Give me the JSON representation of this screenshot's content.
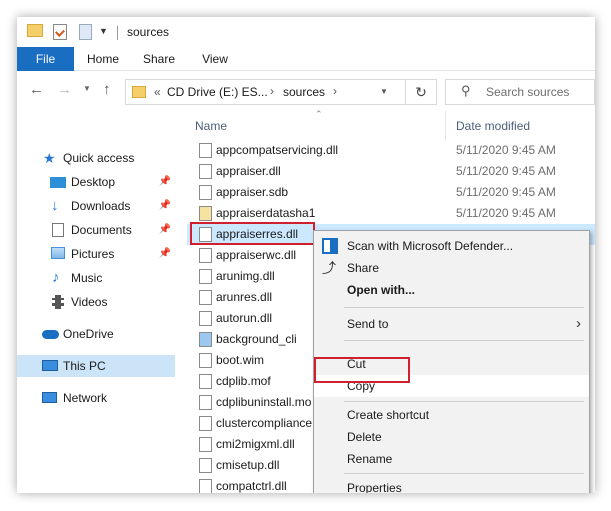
{
  "window": {
    "title": "sources"
  },
  "ribbon": {
    "tabs": [
      "File",
      "Home",
      "Share",
      "View"
    ]
  },
  "address": {
    "overflow": "«",
    "crumbs": [
      "CD Drive (E:) ES...",
      "sources"
    ],
    "search_placeholder": "Search sources"
  },
  "nav": {
    "quick_access": "Quick access",
    "items": [
      {
        "label": "Desktop",
        "pinned": true
      },
      {
        "label": "Downloads",
        "pinned": true
      },
      {
        "label": "Documents",
        "pinned": true
      },
      {
        "label": "Pictures",
        "pinned": true
      },
      {
        "label": "Music",
        "pinned": false
      },
      {
        "label": "Videos",
        "pinned": false
      }
    ],
    "onedrive": "OneDrive",
    "thispc": "This PC",
    "network": "Network"
  },
  "columns": {
    "name": "Name",
    "date": "Date modified"
  },
  "files": [
    {
      "name": "appcompatservicing.dll",
      "date": "5/11/2020 9:45 AM"
    },
    {
      "name": "appraiser.dll",
      "date": "5/11/2020 9:45 AM"
    },
    {
      "name": "appraiser.sdb",
      "date": "5/11/2020 9:45 AM"
    },
    {
      "name": "appraiserdatasha1",
      "date": "5/11/2020 9:45 AM"
    },
    {
      "name": "appraiserres.dll",
      "date": ""
    },
    {
      "name": "appraiserwc.dll",
      "date": ""
    },
    {
      "name": "arunimg.dll",
      "date": ""
    },
    {
      "name": "arunres.dll",
      "date": ""
    },
    {
      "name": "autorun.dll",
      "date": ""
    },
    {
      "name": "background_cli",
      "date": ""
    },
    {
      "name": "boot.wim",
      "date": ""
    },
    {
      "name": "cdplib.mof",
      "date": ""
    },
    {
      "name": "cdplibuninstall.mo",
      "date": ""
    },
    {
      "name": "clustercompliance",
      "date": ""
    },
    {
      "name": "cmi2migxml.dll",
      "date": ""
    },
    {
      "name": "cmisetup.dll",
      "date": ""
    },
    {
      "name": "compatctrl.dll",
      "date": ""
    }
  ],
  "context_menu": {
    "scan": "Scan with Microsoft Defender...",
    "share": "Share",
    "open_with": "Open with...",
    "send_to": "Send to",
    "cut": "Cut",
    "copy": "Copy",
    "create_shortcut": "Create shortcut",
    "delete": "Delete",
    "rename": "Rename",
    "properties": "Properties"
  },
  "colors": {
    "accent": "#1a6ec2",
    "highlight": "#d0202e",
    "selection": "#cce8ff"
  }
}
